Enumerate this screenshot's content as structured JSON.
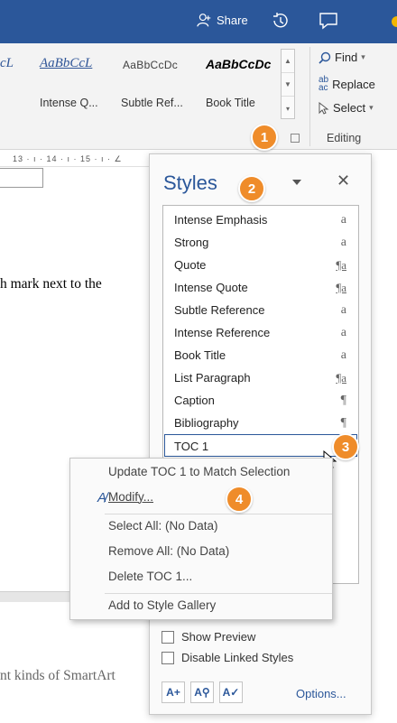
{
  "titlebar": {
    "share_label": "Share",
    "share_icon": "person-add-icon",
    "history_icon": "history-icon",
    "comment_icon": "comment-icon",
    "color": "#2b579a"
  },
  "ribbon": {
    "gallery": [
      {
        "sample": "cL",
        "name": ""
      },
      {
        "sample": "AaBbCcL",
        "name": "Intense Q..."
      },
      {
        "sample": "AaBbCcDc",
        "name": "Subtle Ref..."
      },
      {
        "sample": "AaBbCcDc",
        "name": "Book Title"
      }
    ],
    "editing": {
      "find_label": "Find",
      "replace_label": "Replace",
      "select_label": "Select",
      "group_label": "Editing"
    }
  },
  "ruler_text": "13 · ı · 14 · ı · 15 · ı · ∠",
  "document": {
    "line1": "h mark next to the",
    "line2": "nt kinds of SmartArt"
  },
  "callouts": {
    "c1": "1",
    "c2": "2",
    "c3": "3",
    "c4": "4",
    "color": "#ef8c2a"
  },
  "styles_pane": {
    "title": "Styles",
    "close": "✕",
    "items": [
      {
        "label": "Intense Emphasis",
        "icon": "a",
        "kind": "char"
      },
      {
        "label": "Strong",
        "icon": "a",
        "kind": "char"
      },
      {
        "label": "Quote",
        "icon": "¶a",
        "kind": "linked"
      },
      {
        "label": "Intense Quote",
        "icon": "¶a",
        "kind": "linked"
      },
      {
        "label": "Subtle Reference",
        "icon": "a",
        "kind": "char"
      },
      {
        "label": "Intense Reference",
        "icon": "a",
        "kind": "char"
      },
      {
        "label": "Book Title",
        "icon": "a",
        "kind": "char"
      },
      {
        "label": "List Paragraph",
        "icon": "¶a",
        "kind": "linked"
      },
      {
        "label": "Caption",
        "icon": "¶",
        "kind": "para"
      },
      {
        "label": "Bibliography",
        "icon": "¶",
        "kind": "para"
      },
      {
        "label": "TOC 1",
        "icon": "",
        "kind": "selected"
      }
    ],
    "show_preview": "Show Preview",
    "disable_linked": "Disable Linked Styles",
    "options": "Options..."
  },
  "context_menu": {
    "update": "Update TOC 1 to Match Selection",
    "modify": "Modify...",
    "select_all": "Select All: (No Data)",
    "remove_all": "Remove All: (No Data)",
    "delete": "Delete TOC 1...",
    "add_gallery": "Add to Style Gallery"
  }
}
